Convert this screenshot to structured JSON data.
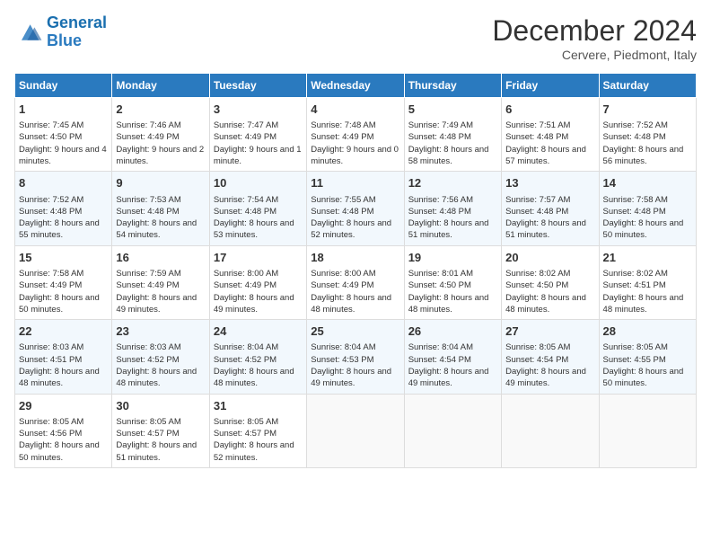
{
  "logo": {
    "line1": "General",
    "line2": "Blue"
  },
  "title": "December 2024",
  "subtitle": "Cervere, Piedmont, Italy",
  "days_header": [
    "Sunday",
    "Monday",
    "Tuesday",
    "Wednesday",
    "Thursday",
    "Friday",
    "Saturday"
  ],
  "weeks": [
    [
      {
        "day": "1",
        "sunrise": "7:45 AM",
        "sunset": "4:50 PM",
        "daylight": "9 hours and 4 minutes."
      },
      {
        "day": "2",
        "sunrise": "7:46 AM",
        "sunset": "4:49 PM",
        "daylight": "9 hours and 2 minutes."
      },
      {
        "day": "3",
        "sunrise": "7:47 AM",
        "sunset": "4:49 PM",
        "daylight": "9 hours and 1 minute."
      },
      {
        "day": "4",
        "sunrise": "7:48 AM",
        "sunset": "4:49 PM",
        "daylight": "9 hours and 0 minutes."
      },
      {
        "day": "5",
        "sunrise": "7:49 AM",
        "sunset": "4:48 PM",
        "daylight": "8 hours and 58 minutes."
      },
      {
        "day": "6",
        "sunrise": "7:51 AM",
        "sunset": "4:48 PM",
        "daylight": "8 hours and 57 minutes."
      },
      {
        "day": "7",
        "sunrise": "7:52 AM",
        "sunset": "4:48 PM",
        "daylight": "8 hours and 56 minutes."
      }
    ],
    [
      {
        "day": "8",
        "sunrise": "7:52 AM",
        "sunset": "4:48 PM",
        "daylight": "8 hours and 55 minutes."
      },
      {
        "day": "9",
        "sunrise": "7:53 AM",
        "sunset": "4:48 PM",
        "daylight": "8 hours and 54 minutes."
      },
      {
        "day": "10",
        "sunrise": "7:54 AM",
        "sunset": "4:48 PM",
        "daylight": "8 hours and 53 minutes."
      },
      {
        "day": "11",
        "sunrise": "7:55 AM",
        "sunset": "4:48 PM",
        "daylight": "8 hours and 52 minutes."
      },
      {
        "day": "12",
        "sunrise": "7:56 AM",
        "sunset": "4:48 PM",
        "daylight": "8 hours and 51 minutes."
      },
      {
        "day": "13",
        "sunrise": "7:57 AM",
        "sunset": "4:48 PM",
        "daylight": "8 hours and 51 minutes."
      },
      {
        "day": "14",
        "sunrise": "7:58 AM",
        "sunset": "4:48 PM",
        "daylight": "8 hours and 50 minutes."
      }
    ],
    [
      {
        "day": "15",
        "sunrise": "7:58 AM",
        "sunset": "4:49 PM",
        "daylight": "8 hours and 50 minutes."
      },
      {
        "day": "16",
        "sunrise": "7:59 AM",
        "sunset": "4:49 PM",
        "daylight": "8 hours and 49 minutes."
      },
      {
        "day": "17",
        "sunrise": "8:00 AM",
        "sunset": "4:49 PM",
        "daylight": "8 hours and 49 minutes."
      },
      {
        "day": "18",
        "sunrise": "8:00 AM",
        "sunset": "4:49 PM",
        "daylight": "8 hours and 48 minutes."
      },
      {
        "day": "19",
        "sunrise": "8:01 AM",
        "sunset": "4:50 PM",
        "daylight": "8 hours and 48 minutes."
      },
      {
        "day": "20",
        "sunrise": "8:02 AM",
        "sunset": "4:50 PM",
        "daylight": "8 hours and 48 minutes."
      },
      {
        "day": "21",
        "sunrise": "8:02 AM",
        "sunset": "4:51 PM",
        "daylight": "8 hours and 48 minutes."
      }
    ],
    [
      {
        "day": "22",
        "sunrise": "8:03 AM",
        "sunset": "4:51 PM",
        "daylight": "8 hours and 48 minutes."
      },
      {
        "day": "23",
        "sunrise": "8:03 AM",
        "sunset": "4:52 PM",
        "daylight": "8 hours and 48 minutes."
      },
      {
        "day": "24",
        "sunrise": "8:04 AM",
        "sunset": "4:52 PM",
        "daylight": "8 hours and 48 minutes."
      },
      {
        "day": "25",
        "sunrise": "8:04 AM",
        "sunset": "4:53 PM",
        "daylight": "8 hours and 49 minutes."
      },
      {
        "day": "26",
        "sunrise": "8:04 AM",
        "sunset": "4:54 PM",
        "daylight": "8 hours and 49 minutes."
      },
      {
        "day": "27",
        "sunrise": "8:05 AM",
        "sunset": "4:54 PM",
        "daylight": "8 hours and 49 minutes."
      },
      {
        "day": "28",
        "sunrise": "8:05 AM",
        "sunset": "4:55 PM",
        "daylight": "8 hours and 50 minutes."
      }
    ],
    [
      {
        "day": "29",
        "sunrise": "8:05 AM",
        "sunset": "4:56 PM",
        "daylight": "8 hours and 50 minutes."
      },
      {
        "day": "30",
        "sunrise": "8:05 AM",
        "sunset": "4:57 PM",
        "daylight": "8 hours and 51 minutes."
      },
      {
        "day": "31",
        "sunrise": "8:05 AM",
        "sunset": "4:57 PM",
        "daylight": "8 hours and 52 minutes."
      },
      null,
      null,
      null,
      null
    ]
  ]
}
